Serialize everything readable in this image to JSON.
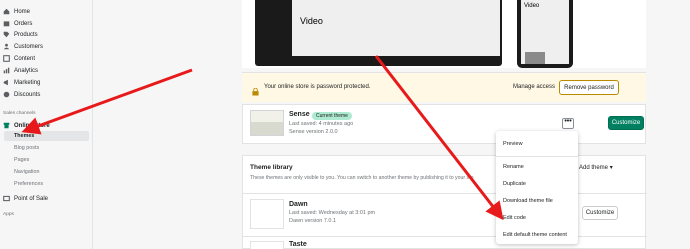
{
  "sidebar": {
    "items": [
      {
        "label": "Home",
        "icon": "home-icon"
      },
      {
        "label": "Orders",
        "icon": "orders-icon"
      },
      {
        "label": "Products",
        "icon": "products-icon"
      },
      {
        "label": "Customers",
        "icon": "customers-icon"
      },
      {
        "label": "Content",
        "icon": "content-icon"
      },
      {
        "label": "Analytics",
        "icon": "analytics-icon"
      },
      {
        "label": "Marketing",
        "icon": "marketing-icon"
      },
      {
        "label": "Discounts",
        "icon": "discounts-icon"
      }
    ],
    "sales_channels_label": "Sales channels",
    "online_store_label": "Online Store",
    "online_store_sub": [
      "Themes",
      "Blog posts",
      "Pages",
      "Navigation",
      "Preferences"
    ],
    "point_of_sale_label": "Point of Sale",
    "apps_label": "Apps"
  },
  "preview": {
    "desktop_label": "Video",
    "mobile_label": "Video"
  },
  "banner": {
    "message": "Your online store is password protected.",
    "manage_access": "Manage access",
    "remove_password": "Remove password"
  },
  "current_theme": {
    "name": "Sense",
    "badge": "Current theme",
    "last_saved": "Last saved: 4 minutes ago",
    "version": "Sense version 2.0.0",
    "customize": "Customize",
    "more": "•••"
  },
  "library": {
    "title": "Theme library",
    "description": "These themes are only visible to you. You can switch to another theme by publishing it to your sto",
    "add_theme": "Add theme",
    "themes": [
      {
        "name": "Dawn",
        "last_saved": "Last saved: Wednesday at 3:01 pm",
        "version": "Dawn version 7.0.1",
        "customize": "Customize"
      },
      {
        "name": "Taste"
      }
    ]
  },
  "menu": {
    "items": [
      "Preview",
      "Rename",
      "Duplicate",
      "Download theme file",
      "Edit code",
      "Edit default theme content"
    ]
  },
  "colors": {
    "accent": "#008060",
    "arrow": "#e8191a",
    "banner_bg": "#fff8e5",
    "badge_bg": "#aee9d1"
  }
}
